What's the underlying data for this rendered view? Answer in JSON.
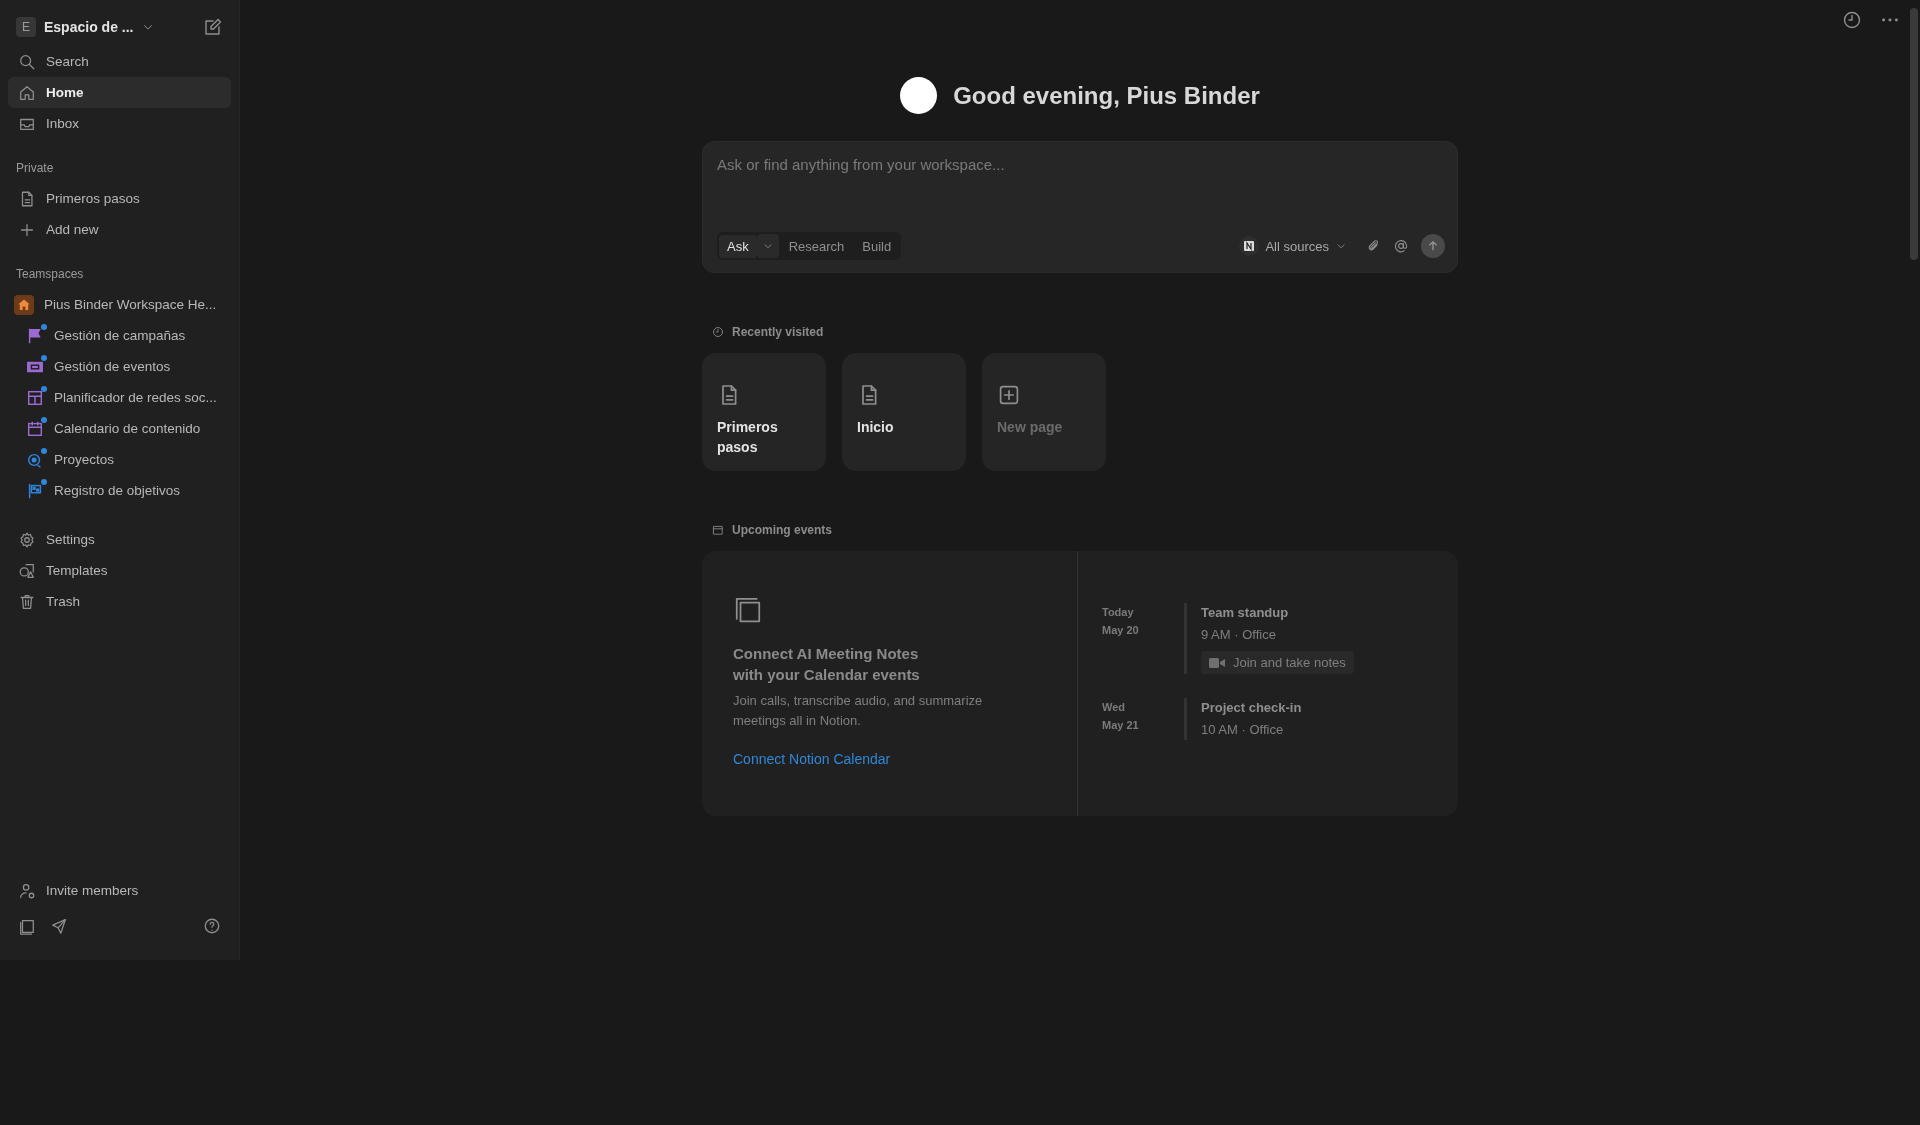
{
  "sidebar": {
    "workspace": {
      "initial": "E",
      "name": "Espacio de ..."
    },
    "nav": [
      {
        "label": "Search",
        "selected": false
      },
      {
        "label": "Home",
        "selected": true
      },
      {
        "label": "Inbox",
        "selected": false
      }
    ],
    "private": {
      "heading": "Private",
      "items": [
        {
          "label": "Primeros pasos"
        }
      ],
      "add_new": "Add new"
    },
    "teamspaces": {
      "heading": "Teamspaces",
      "teamspace": "Pius Binder Workspace He...",
      "pages": [
        {
          "label": "Gestión de campañas",
          "color": "#9b6bd3"
        },
        {
          "label": "Gestión de eventos",
          "color": "#9b6bd3"
        },
        {
          "label": "Planificador de redes soc...",
          "color": "#9b6bd3"
        },
        {
          "label": "Calendario de contenido",
          "color": "#9b6bd3"
        },
        {
          "label": "Proyectos",
          "color": "#2e86de"
        },
        {
          "label": "Registro de objetivos",
          "color": "#2e86de"
        }
      ]
    },
    "tools": [
      "Settings",
      "Templates",
      "Trash"
    ],
    "invite": "Invite members"
  },
  "main": {
    "greeting": "Good evening, Pius Binder",
    "composer": {
      "placeholder": "Ask or find anything from your workspace...",
      "modes": [
        {
          "label": "Ask",
          "selected": true
        },
        {
          "label": "Research",
          "selected": false
        },
        {
          "label": "Build",
          "selected": false
        }
      ],
      "sources": "All sources"
    },
    "recently_visited": {
      "heading": "Recently visited",
      "cards": [
        {
          "title": "Primeros pasos",
          "kind": "page"
        },
        {
          "title": "Inicio",
          "kind": "page"
        },
        {
          "title": "New page",
          "kind": "new"
        }
      ]
    },
    "upcoming": {
      "heading": "Upcoming events",
      "promo": {
        "title": "Connect AI Meeting Notes\nwith your Calendar events",
        "body": "Join calls, transcribe audio, and summarize meetings all in Notion.",
        "link": "Connect Notion Calendar"
      },
      "events": [
        {
          "day": "Today",
          "date": "May 20",
          "title": "Team standup",
          "time": "9 AM · Office",
          "action": "Join and take notes"
        },
        {
          "day": "Wed",
          "date": "May 21",
          "title": "Project check-in",
          "time": "10 AM · Office"
        }
      ]
    }
  }
}
